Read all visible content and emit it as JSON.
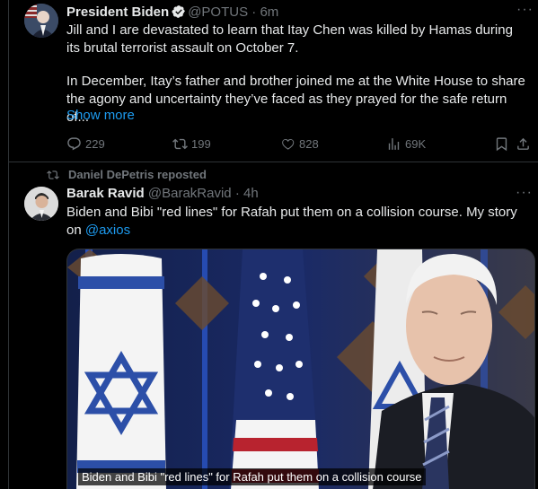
{
  "tweet1": {
    "name": "President Biden",
    "handle": "@POTUS",
    "time": "· 6m",
    "text1": "Jill and I are devastated to learn that Itay Chen was killed by Hamas during its brutal terrorist assault on October 7.",
    "text2": "In December, Itay’s father and brother joined me at the White House to share the agony and uncertainty they’ve faced as they prayed for the safe return of...",
    "show_more": "Show more",
    "replies": "229",
    "reposts": "199",
    "likes": "828",
    "views": "69K"
  },
  "tweet2": {
    "reposted_by": "Daniel DePetris reposted",
    "name": "Barak Ravid",
    "handle": "@BarakRavid",
    "time": "· 4h",
    "text": "Biden and Bibi \"red lines\" for Rafah put them on a collision course. My story on",
    "mention": "@axios",
    "caption": "Biden and Bibi \"red lines\" for Rafah put them on a collision course"
  },
  "colors": {
    "accent": "#1d9bf0",
    "muted": "#71767b",
    "text": "#e7e9ea",
    "bg": "#000000"
  }
}
